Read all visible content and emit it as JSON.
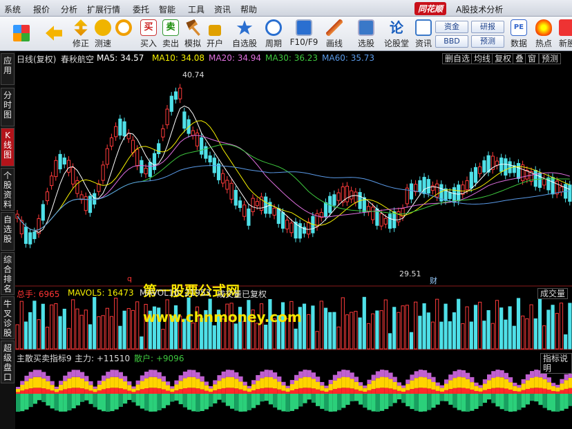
{
  "menu": [
    "系统",
    "报价",
    "分析",
    "扩展行情",
    "委托",
    "智能",
    "工具",
    "资讯",
    "帮助"
  ],
  "brand": "同花顺",
  "app_title": "A股技术分析",
  "toolbar": {
    "buttons": [
      {
        "label": ""
      },
      {
        "label": ""
      },
      {
        "label": "修正"
      },
      {
        "label": "测速"
      },
      {
        "label": "买入"
      },
      {
        "label": "卖出"
      },
      {
        "label": "模拟"
      },
      {
        "label": "开户"
      },
      {
        "label": "自选股"
      },
      {
        "label": "周期"
      },
      {
        "label": "F10/F9"
      },
      {
        "label": "画线"
      },
      {
        "label": "选股"
      },
      {
        "label": "论股堂"
      },
      {
        "label": "资讯"
      },
      {
        "label": "数据"
      },
      {
        "label": "热点"
      },
      {
        "label": "新股"
      }
    ],
    "mini": [
      "资金",
      "研报",
      "BBD",
      "预测"
    ]
  },
  "sidebar": [
    {
      "label": "应用"
    },
    {
      "label": "分时图"
    },
    {
      "label": "K线图"
    },
    {
      "label": "个股资料"
    },
    {
      "label": "自选股"
    },
    {
      "label": "综合排名"
    },
    {
      "label": "牛叉诊股"
    },
    {
      "label": "超级盘口"
    }
  ],
  "price_header": {
    "period": "日线(复权)",
    "stock": "春秋航空",
    "ma5": "MA5: 34.57",
    "ma10": "MA10: 34.08",
    "ma20": "MA20: 34.94",
    "ma30": "MA30: 36.23",
    "ma60": "MA60: 35.73",
    "right_buttons": [
      "删自选",
      "均线",
      "复权",
      "叠",
      "窗",
      "预测"
    ]
  },
  "annotations": {
    "high": "40.74",
    "low": "29.51",
    "q_mark": "q",
    "cai": "财"
  },
  "watermark": {
    "line1": "第一股票公式网",
    "line2": "www.chnmoney.com"
  },
  "volume_header": {
    "total": "总手: 6965",
    "mavol5": "MAVOL5: 16473",
    "mavol10": "MAVOL10: 21953",
    "note": "成交量已复权",
    "right": "成交量"
  },
  "indicator_header": {
    "name": "主散买卖指标9",
    "main": "主力: +11510",
    "retail": "散户: +9096",
    "right": "指标说明"
  },
  "colors": {
    "up": "#ff3b3b",
    "down": "#4fe0e8",
    "ma5": "#ffffff",
    "ma10": "#f5f000",
    "ma20": "#e070e0",
    "ma30": "#3ec83e",
    "ma60": "#5a9ae8"
  }
}
